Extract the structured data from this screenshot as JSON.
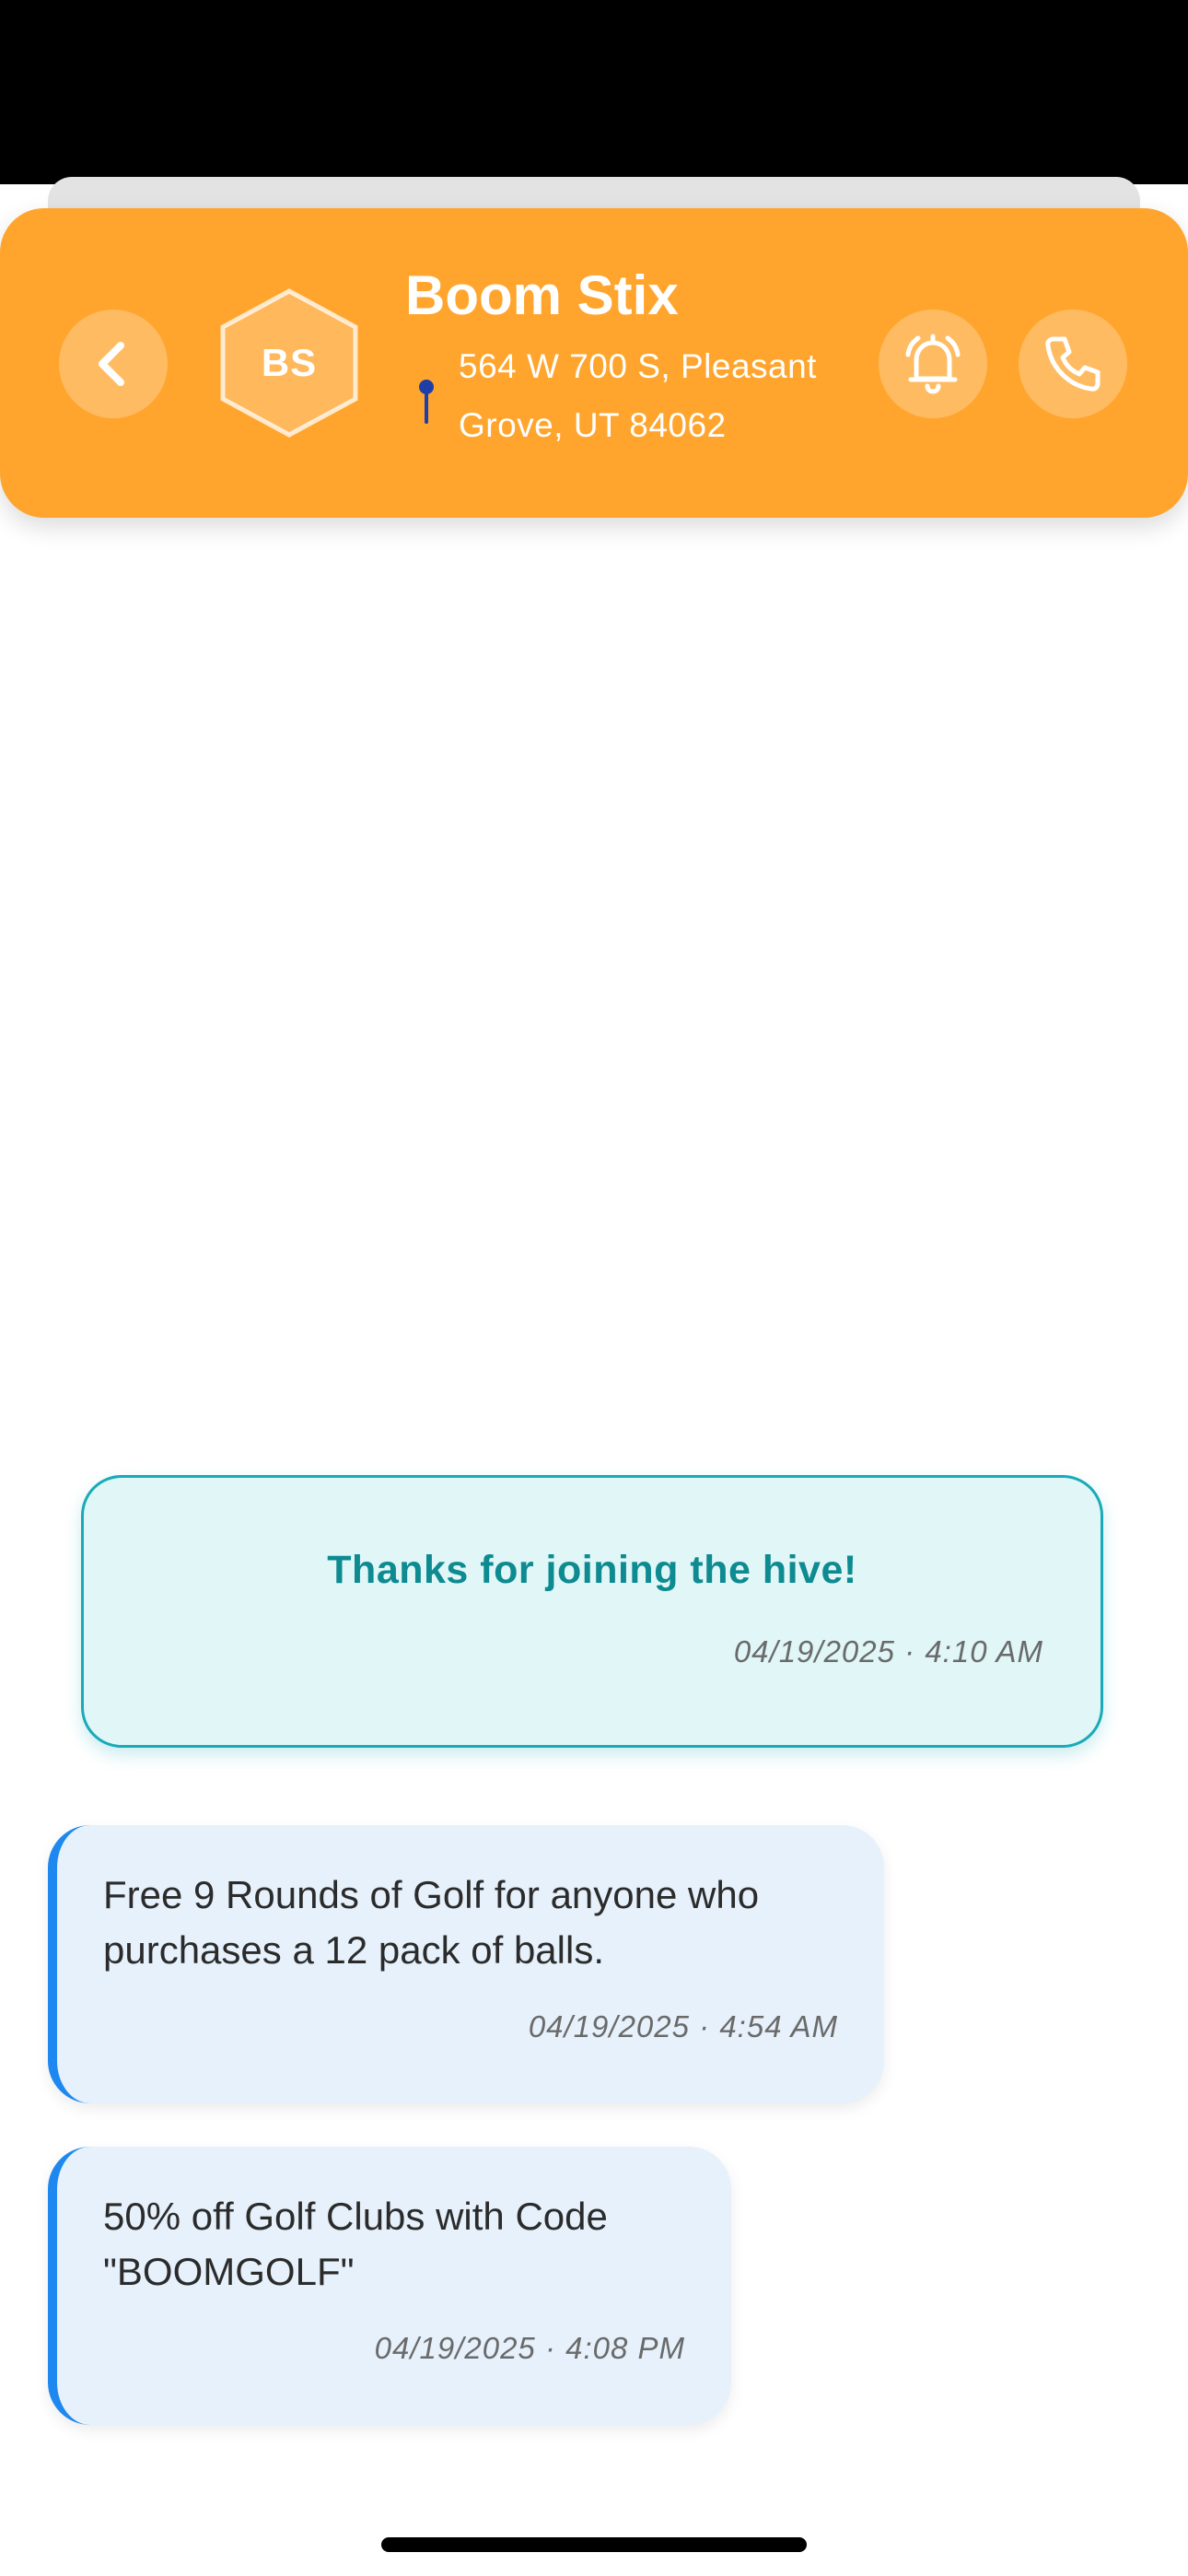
{
  "header": {
    "avatar_initials": "BS",
    "business_name": "Boom Stix",
    "address_line1": "564 W 700 S, Pleasant",
    "address_line2": "Grove, UT 84062",
    "accent_color": "#ffa52e",
    "icons": [
      "chevron-left-icon",
      "map-pin-icon",
      "bell-icon",
      "phone-icon"
    ]
  },
  "welcome": {
    "text": "Thanks for joining the hive!",
    "timestamp": "04/19/2025 · 4:10 AM"
  },
  "messages": [
    {
      "line1": "Free 9 Rounds of Golf for anyone who",
      "line2": "purchases a 12 pack of balls.",
      "timestamp": "04/19/2025 · 4:54 AM"
    },
    {
      "line1": "50% off Golf Clubs with Code",
      "line2": "\"BOOMGOLF\"",
      "timestamp": "04/19/2025 · 4:08 PM"
    }
  ]
}
